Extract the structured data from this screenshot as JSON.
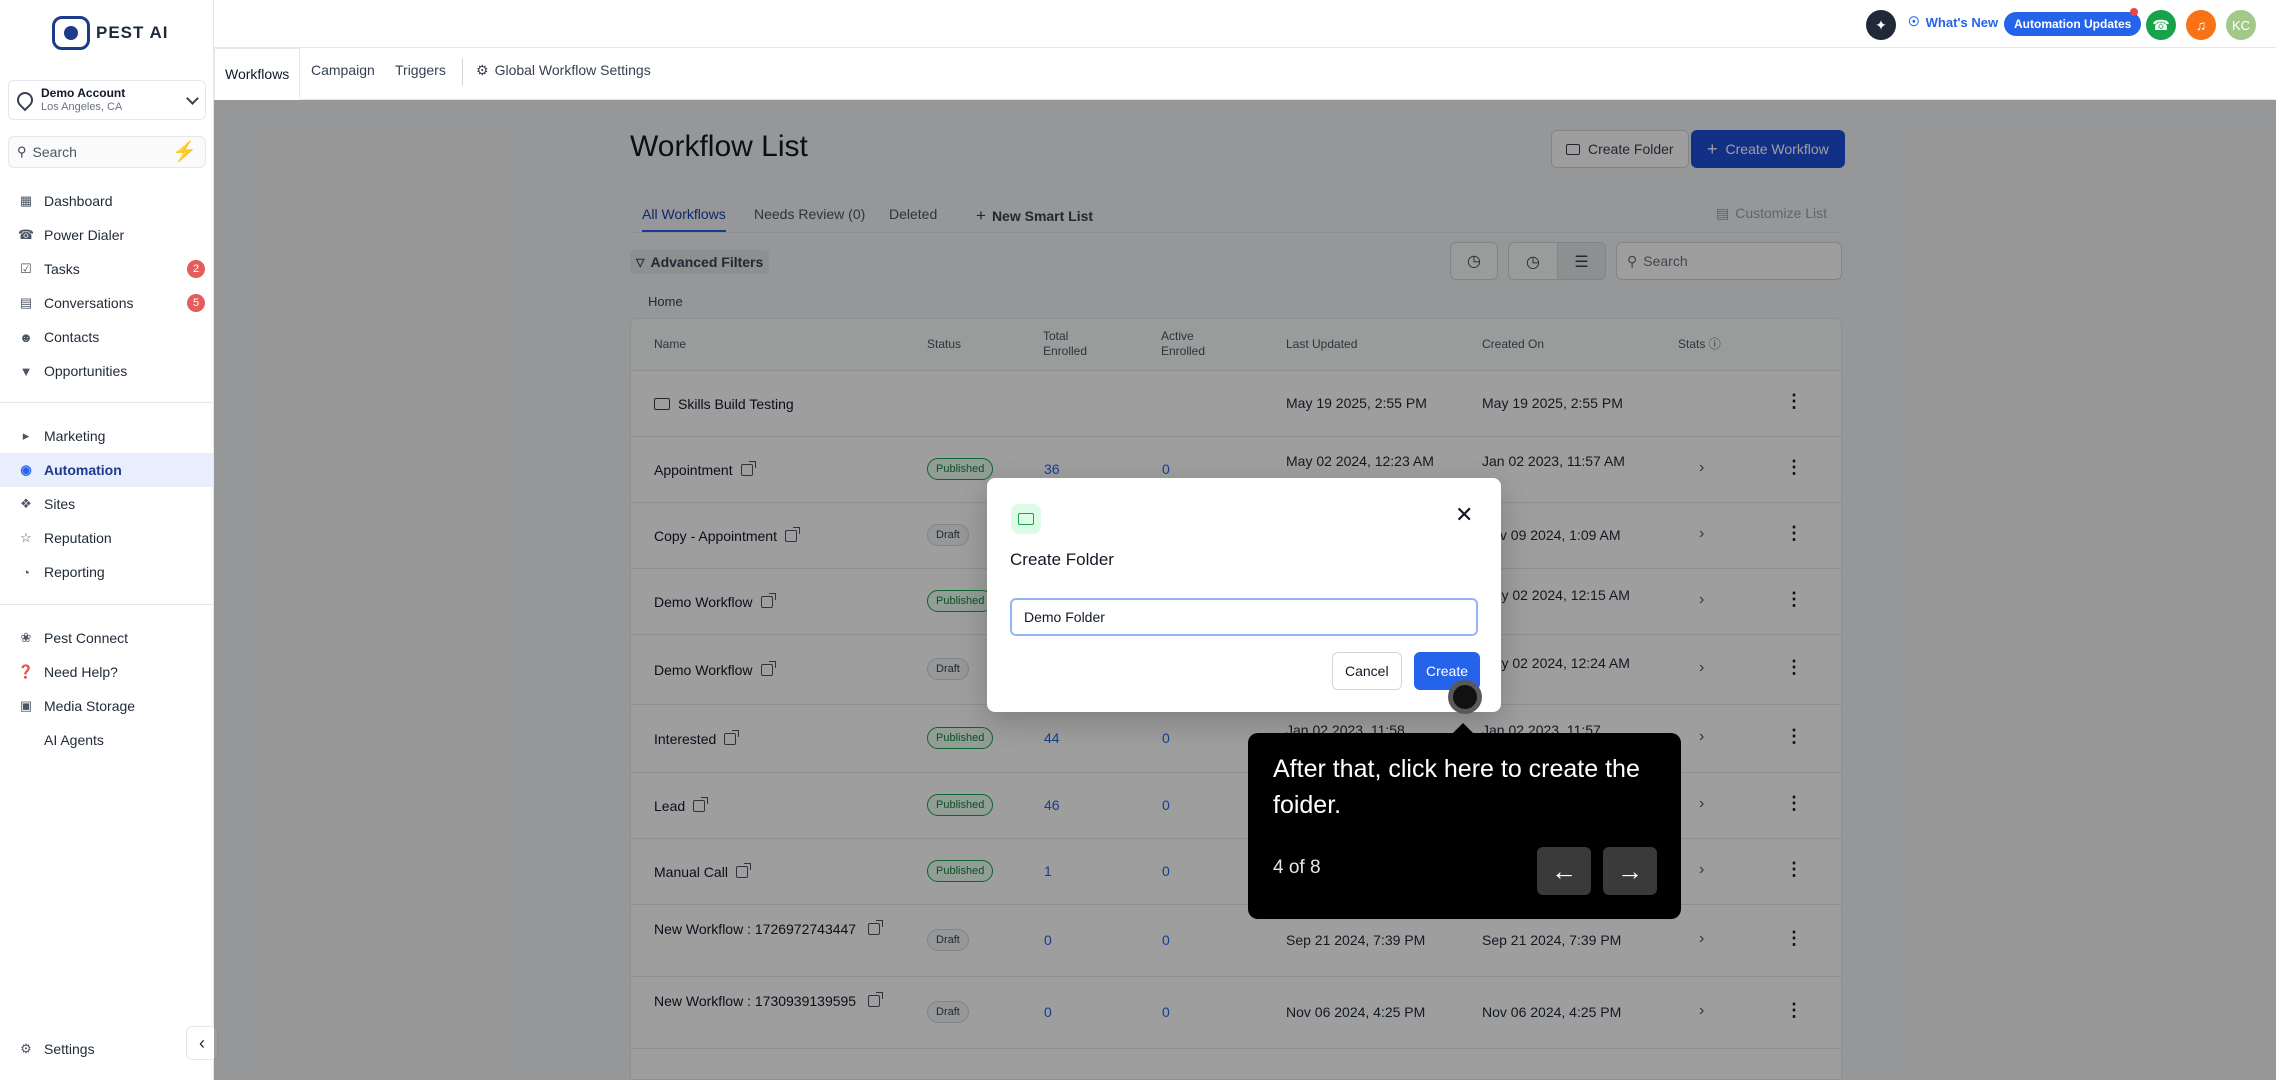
{
  "brand": {
    "name": "PEST AI"
  },
  "account": {
    "name": "Demo Account",
    "location": "Los Angeles, CA"
  },
  "sidebar": {
    "search_label": "Search",
    "items": [
      {
        "label": "Dashboard",
        "icon": "dashboard-icon"
      },
      {
        "label": "Power Dialer",
        "icon": "phone-icon"
      },
      {
        "label": "Tasks",
        "icon": "check-icon",
        "badge": "2"
      },
      {
        "label": "Conversations",
        "icon": "chat-icon",
        "badge": "5"
      },
      {
        "label": "Contacts",
        "icon": "user-icon"
      },
      {
        "label": "Opportunities",
        "icon": "filter-icon"
      },
      {
        "label": "Marketing",
        "icon": "megaphone-icon"
      },
      {
        "label": "Automation",
        "icon": "automation-icon",
        "active": true
      },
      {
        "label": "Sites",
        "icon": "sites-icon"
      },
      {
        "label": "Reputation",
        "icon": "star-icon"
      },
      {
        "label": "Reporting",
        "icon": "chart-icon"
      },
      {
        "label": "Pest Connect",
        "icon": "connect-icon"
      },
      {
        "label": "Need Help?",
        "icon": "help-icon"
      },
      {
        "label": "Media Storage",
        "icon": "image-icon"
      },
      {
        "label": "AI Agents",
        "icon": ""
      }
    ],
    "settings_label": "Settings"
  },
  "topbar": {
    "whats_new": "What's New",
    "updates": "Automation Updates",
    "avatar": "KC"
  },
  "tabs": [
    "Workflows",
    "Campaign",
    "Triggers",
    "Global Workflow Settings"
  ],
  "main": {
    "title": "Workflow List",
    "create_folder": "Create Folder",
    "create_workflow": "Create Workflow",
    "list_tabs": [
      "All Workflows",
      "Needs Review (0)",
      "Deleted",
      "New Smart List"
    ],
    "customize": "Customize List",
    "advanced_filters": "Advanced Filters",
    "search_placeholder": "Search",
    "breadcrumb": "Home"
  },
  "table": {
    "headers": [
      "Name",
      "Status",
      "Total Enrolled",
      "Active Enrolled",
      "Last Updated",
      "Created On",
      "Stats"
    ],
    "rows": [
      {
        "name": "Skills Build Testing",
        "folder": true,
        "status": "",
        "total": "",
        "active": "",
        "updated": "May 19 2025, 2:55 PM",
        "created": "May 19 2025, 2:55 PM"
      },
      {
        "name": "Appointment",
        "status": "Published",
        "total": "36",
        "active": "0",
        "updated": "May 02 2024, 12:23 AM",
        "created": "Jan 02 2023, 11:57 AM"
      },
      {
        "name": "Copy - Appointment",
        "status": "Draft",
        "total": "",
        "active": "",
        "updated": "",
        "created": "Nov 09 2024, 1:09 AM"
      },
      {
        "name": "Demo Workflow",
        "status": "Published",
        "total": "",
        "active": "",
        "updated": "",
        "created": "May 02 2024, 12:15 AM"
      },
      {
        "name": "Demo Workflow",
        "status": "Draft",
        "total": "",
        "active": "",
        "updated": "",
        "created": "May 02 2024, 12:24 AM"
      },
      {
        "name": "Interested",
        "status": "Published",
        "total": "44",
        "active": "0",
        "updated": "Jan 02 2023, 11:58",
        "created": "Jan 02 2023, 11:57"
      },
      {
        "name": "Lead",
        "status": "Published",
        "total": "46",
        "active": "0",
        "updated": "",
        "created": ""
      },
      {
        "name": "Manual Call",
        "status": "Published",
        "total": "1",
        "active": "0",
        "updated": "",
        "created": ""
      },
      {
        "name": "New Workflow : 1726972743447",
        "status": "Draft",
        "total": "0",
        "active": "0",
        "updated": "Sep 21 2024, 7:39 PM",
        "created": "Sep 21 2024, 7:39 PM"
      },
      {
        "name": "New Workflow : 1730939139595",
        "status": "Draft",
        "total": "0",
        "active": "0",
        "updated": "Nov 06 2024, 4:25 PM",
        "created": "Nov 06 2024, 4:25 PM"
      }
    ]
  },
  "modal": {
    "title": "Create Folder",
    "input_value": "Demo Folder",
    "cancel": "Cancel",
    "create": "Create"
  },
  "tooltip": {
    "text": "After that, click here to create the foider.",
    "step": "4 of 8"
  }
}
